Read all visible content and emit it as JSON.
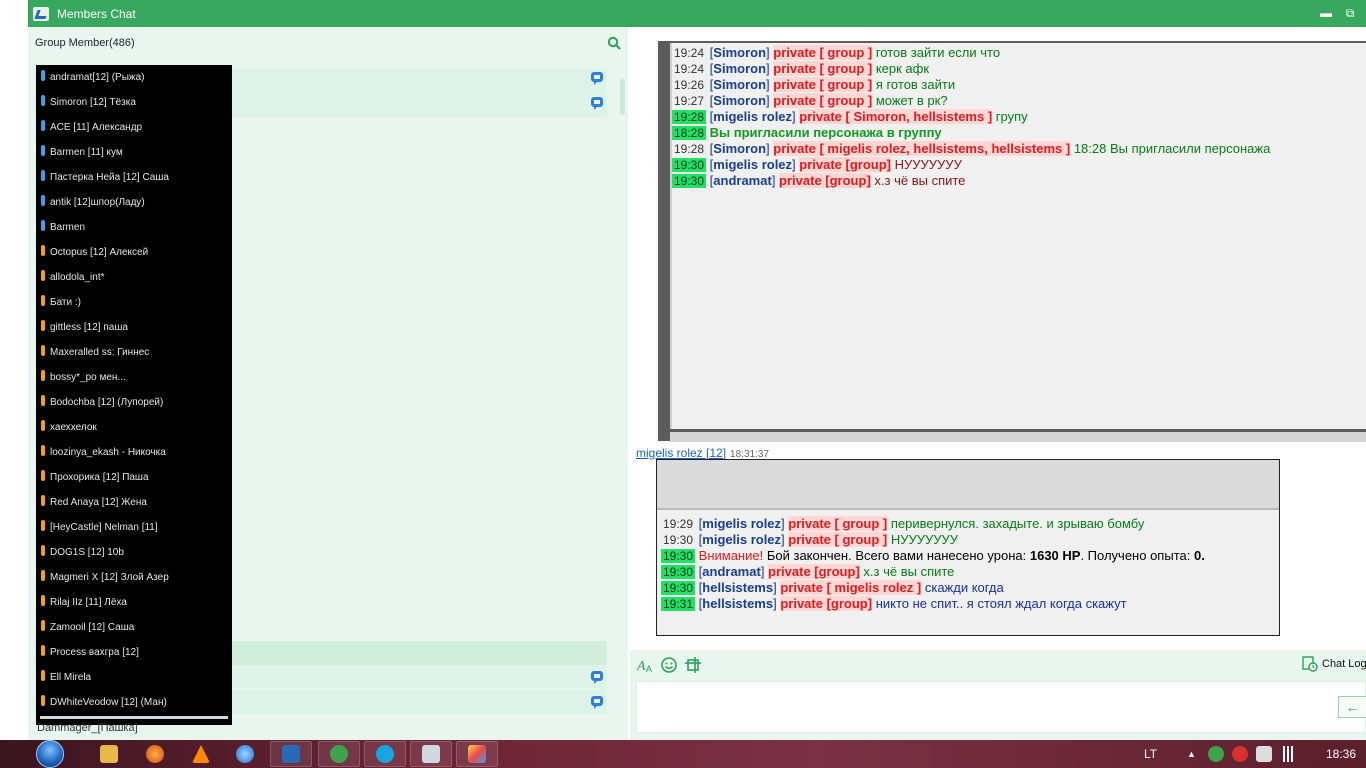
{
  "window": {
    "title": "Members Chat",
    "minimize": "▬",
    "restore": "⧉"
  },
  "members_panel": {
    "header": "Group Member(486)",
    "search_icon": "search-icon",
    "members": [
      {
        "name": "andramat[12] (Рыжа)",
        "color": "#3da0e8"
      },
      {
        "name": "Simoron [12] Тёзка",
        "color": "#3da0e8"
      },
      {
        "name": "ACE [11] Александр",
        "color": "#3da0e8"
      },
      {
        "name": "Barmen [11] кум",
        "color": "#3da0e8"
      },
      {
        "name": "Пастерка Нейа [12] Саша",
        "color": "#3da0e8"
      },
      {
        "name": "antik [12]шпор(Ладу)",
        "color": "#3da0e8"
      },
      {
        "name": "Barmen",
        "color": "#3da0e8"
      },
      {
        "name": "Octopus [12] Алексей",
        "color": "#f0a020"
      },
      {
        "name": "allodola_int*",
        "color": "#f0a020"
      },
      {
        "name": "Бати :)",
        "color": "#f0a020"
      },
      {
        "name": "gittless [12] паша",
        "color": "#f0a020"
      },
      {
        "name": "Maxeralled ss: Гиннес",
        "color": "#f0a020"
      },
      {
        "name": "bossy*_ро мен...",
        "color": "#f0a020"
      },
      {
        "name": "Bodochba [12] (Лупорей)",
        "color": "#f0a020"
      },
      {
        "name": "хаеххелок",
        "color": "#f0a020"
      },
      {
        "name": "loozinya_ekash - Никочка",
        "color": "#f0a020"
      },
      {
        "name": "Прохорика [12] Паша",
        "color": "#f0a020"
      },
      {
        "name": "Red Anaya [12] Жена",
        "color": "#f0a020"
      },
      {
        "name": "[HeyCastle] Nelman [11]",
        "color": "#f0a020"
      },
      {
        "name": "DOG1S [12] 10b",
        "color": "#f0a020"
      },
      {
        "name": "Magmeri X [12] Злой Азер",
        "color": "#f0a020"
      },
      {
        "name": "Rilaj IIz [11] Лёха",
        "color": "#f0a020"
      },
      {
        "name": "Zamooil [12] Саша",
        "color": "#f0a020"
      },
      {
        "name": "Process вахгра [12]",
        "color": "#f0a020"
      },
      {
        "name": "Ell Mirela",
        "color": "#f0a020"
      },
      {
        "name": "DWhiteVeodow [12] (Ман)",
        "color": "#f0a020"
      }
    ],
    "bottom_member": "Dammager_[Пашка]"
  },
  "chat_log": [
    {
      "time": "19:24",
      "hl": false,
      "name": "Simoron",
      "channel": "private [ group ]",
      "text": "готов зайти если что",
      "color": "green"
    },
    {
      "time": "19:24",
      "hl": false,
      "name": "Simoron",
      "channel": "private [ group ]",
      "text": "керк афк",
      "color": "green"
    },
    {
      "time": "19:26",
      "hl": false,
      "name": "Simoron",
      "channel": "private [ group ]",
      "text": "я готов зайти",
      "color": "green"
    },
    {
      "time": "19:27",
      "hl": false,
      "name": "Simoron",
      "channel": "private [ group ]",
      "text": "может в рк?",
      "color": "green"
    },
    {
      "time": "19:28",
      "hl": true,
      "name": "migelis rolez",
      "channel": "private [ Simoron, hellsistems ]",
      "text": "групу",
      "color": "green"
    },
    {
      "time": "18:28",
      "hl": true,
      "system": "Вы пригласили персонажа в группу"
    },
    {
      "time": "19:28",
      "hl": false,
      "name": "Simoron",
      "channel": "private [ migelis rolez, hellsistems, hellsistems ]",
      "text": "18:28 Вы пригласили персонажа",
      "color": "green"
    },
    {
      "time": "19:30",
      "hl": true,
      "name": "migelis rolez",
      "channel": "private [group]",
      "text": "НУУУУУУУ",
      "color": "red"
    },
    {
      "time": "19:30",
      "hl": true,
      "name": "andramat",
      "channel": "private [group]",
      "text": "х.з чё вы спите",
      "color": "red"
    }
  ],
  "sender": {
    "name": "migelis rolez [12]",
    "time": "18:31:37"
  },
  "quoted_log": [
    {
      "time": "19:29",
      "hl": false,
      "name": "migelis rolez",
      "channel": "private [ group ]",
      "text": "перивернулся. захадыте. и зрываю бомбу",
      "color": "green"
    },
    {
      "time": "19:30",
      "hl": false,
      "name": "migelis rolez",
      "channel": "private [ group ]",
      "text": "НУУУУУУУ",
      "color": "green"
    },
    {
      "time": "19:30",
      "hl": true,
      "warning": "Внимание!",
      "pre": "Бой закончен. Всего вами нанесено урона:",
      "dmg": "1630 HP",
      "mid": ". Получено опыта:",
      "exp": "0."
    },
    {
      "time": "19:30",
      "hl": true,
      "name": "andramat",
      "channel": "private [group]",
      "text": "х.з чё вы спите",
      "color": "green"
    },
    {
      "time": "19:30",
      "hl": true,
      "name": "hellsistems",
      "channel": "private [ migelis rolez ]",
      "text": "скажди когда",
      "color": "blue"
    },
    {
      "time": "19:31",
      "hl": true,
      "name": "hellsistems",
      "channel": "private [group]",
      "text": "никто не спит.. я стоял ждал когда скажут",
      "color": "blue"
    }
  ],
  "toolbar": {
    "chat_log_label": "Chat Log",
    "send_arrow": "←"
  },
  "taskbar": {
    "lang": "LT",
    "clock": "18:36"
  }
}
